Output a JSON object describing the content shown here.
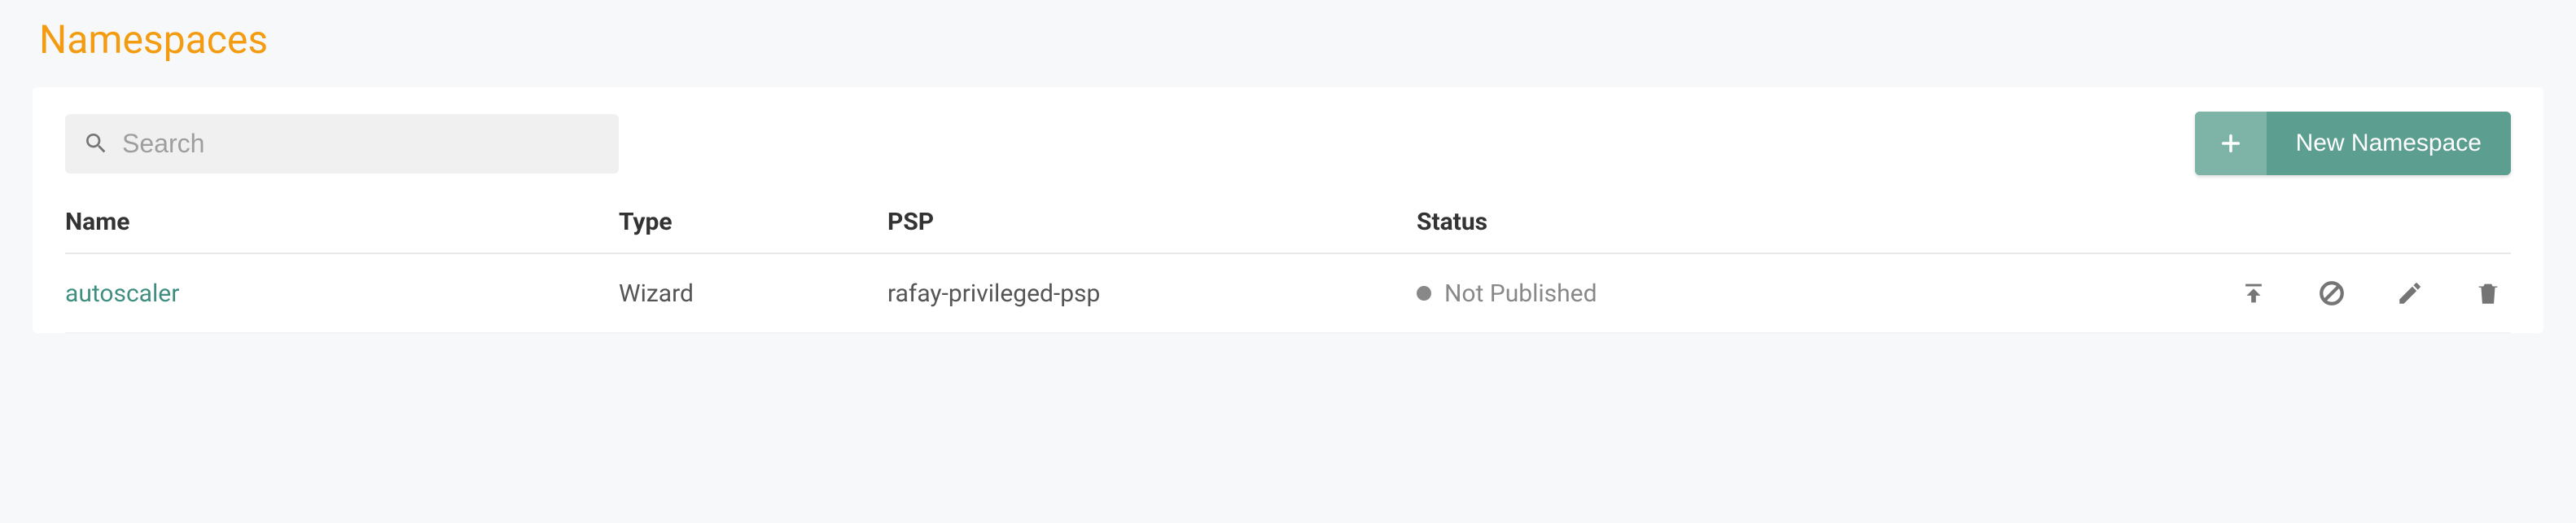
{
  "page": {
    "title": "Namespaces"
  },
  "search": {
    "placeholder": "Search",
    "value": ""
  },
  "actions": {
    "new_namespace_label": "New Namespace"
  },
  "table": {
    "headers": {
      "name": "Name",
      "type": "Type",
      "psp": "PSP",
      "status": "Status"
    },
    "rows": [
      {
        "name": "autoscaler",
        "type": "Wizard",
        "psp": "rafay-privileged-psp",
        "status": "Not Published"
      }
    ]
  },
  "icons": {
    "publish": "publish-icon",
    "disable": "disable-icon",
    "edit": "edit-icon",
    "delete": "delete-icon"
  }
}
